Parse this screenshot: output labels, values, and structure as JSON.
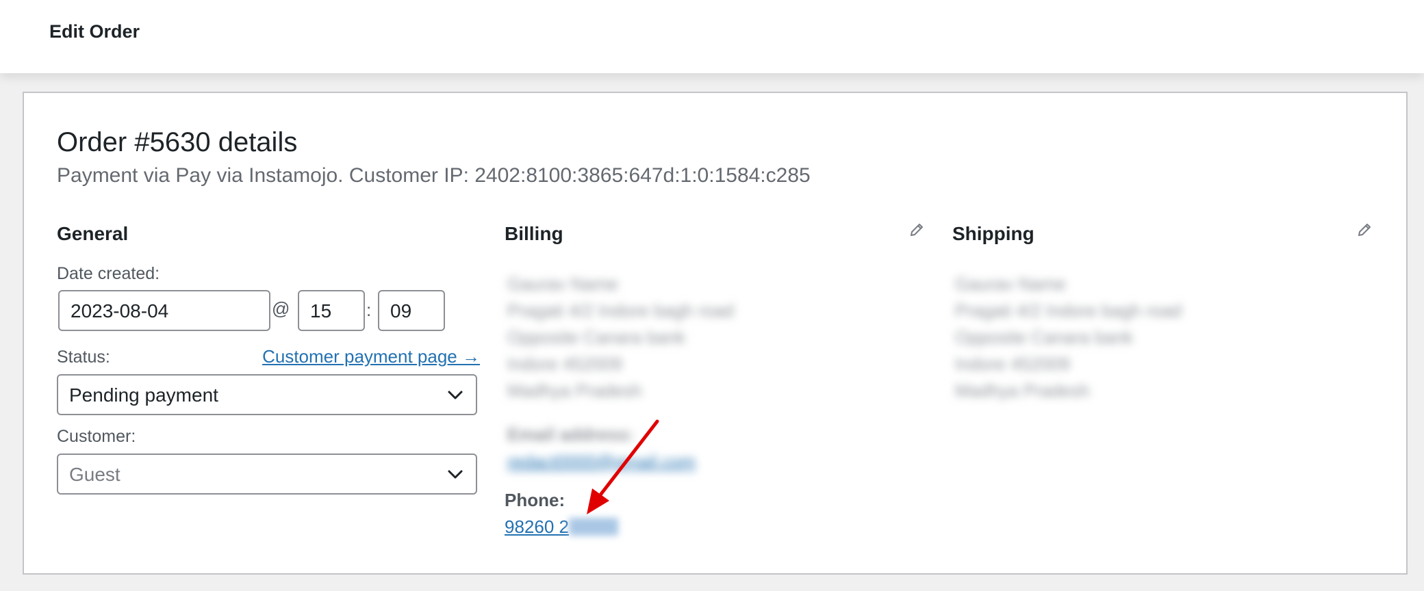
{
  "header": {
    "title": "Edit Order"
  },
  "order": {
    "title": "Order #5630 details",
    "meta": "Payment via Pay via Instamojo. Customer IP: 2402:8100:3865:647d:1:0:1584:c285"
  },
  "general": {
    "heading": "General",
    "date_label": "Date created:",
    "date_value": "2023-08-04",
    "at_symbol": "@",
    "hour_value": "15",
    "colon": ":",
    "minute_value": "09",
    "status_label": "Status:",
    "payment_link": "Customer payment page →",
    "status_value": "Pending payment",
    "customer_label": "Customer:",
    "customer_value": "Guest"
  },
  "billing": {
    "heading": "Billing",
    "address_lines": [
      "Gaurav Name",
      "Pragati 4/2 Indore bagh road",
      "Opposite Canara bank",
      "Indore 452009",
      "Madhya Pradesh"
    ],
    "email_label": "Email address:",
    "email_value": "redact0000@gmail.com",
    "phone_label": "Phone:",
    "phone_value": "98260 2"
  },
  "shipping": {
    "heading": "Shipping",
    "address_lines": [
      "Gaurav Name",
      "Pragati 4/2 Indore bagh road",
      "Opposite Canara bank",
      "Indore 452009",
      "Madhya Pradesh"
    ]
  },
  "colors": {
    "link": "#2271b1",
    "arrow": "#e00000",
    "text": "#1d2327"
  },
  "icons": {
    "edit": "pencil-icon",
    "dropdown": "chevron-down-icon"
  }
}
